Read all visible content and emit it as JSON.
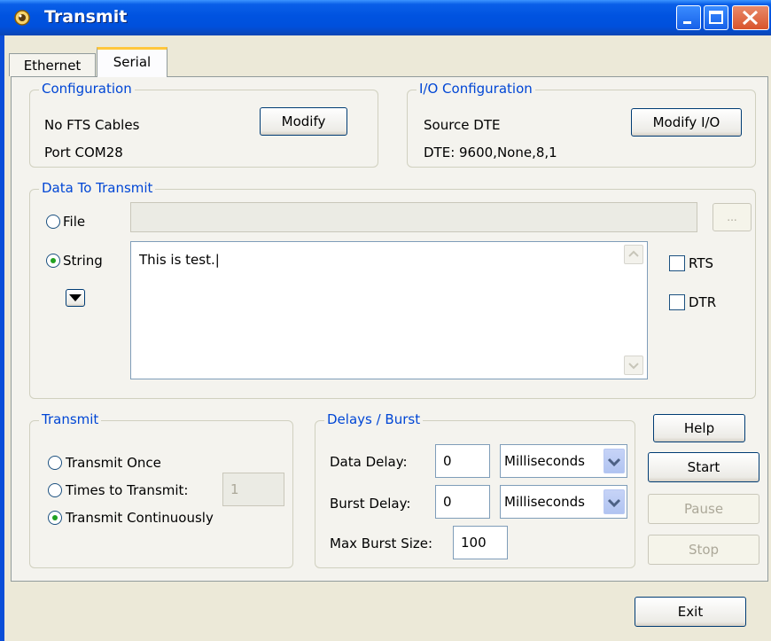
{
  "window": {
    "title": "Transmit"
  },
  "tabs": [
    {
      "label": "Ethernet"
    },
    {
      "label": "Serial"
    }
  ],
  "configuration": {
    "legend": "Configuration",
    "cables": "No FTS Cables",
    "port": "Port COM28",
    "modify_label": "Modify"
  },
  "io_configuration": {
    "legend": "I/O Configuration",
    "source": "Source DTE",
    "dte": "DTE:  9600,None,8,1",
    "modify_label": "Modify I/O"
  },
  "data_to_transmit": {
    "legend": "Data To Transmit",
    "file_label": "File",
    "file_path": "",
    "browse_label": "...",
    "string_label": "String",
    "string_value": "This is test.|",
    "rts_label": "RTS",
    "dtr_label": "DTR"
  },
  "transmit": {
    "legend": "Transmit",
    "once_label": "Transmit Once",
    "times_label": "Times to Transmit:",
    "times_value": "1",
    "continuous_label": "Transmit Continuously",
    "selected": "continuous"
  },
  "delays": {
    "legend": "Delays / Burst",
    "data_delay_label": "Data Delay:",
    "data_delay_value": "0",
    "data_delay_unit": "Milliseconds",
    "burst_delay_label": "Burst Delay:",
    "burst_delay_value": "0",
    "burst_delay_unit": "Milliseconds",
    "max_burst_label": "Max Burst Size:",
    "max_burst_value": "100"
  },
  "actions": {
    "help": "Help",
    "start": "Start",
    "pause": "Pause",
    "stop": "Stop",
    "exit": "Exit"
  },
  "colors": {
    "title_bar": "#0053e0",
    "group_legend": "#0046d5",
    "tab_highlight": "#ffc73c",
    "radio_dot": "#21a121"
  },
  "icons": [
    "app-icon",
    "minimize-icon",
    "maximize-icon",
    "close-icon",
    "dropdown-arrow-icon",
    "scroll-up-icon",
    "scroll-down-icon",
    "combo-arrow-icon"
  ]
}
